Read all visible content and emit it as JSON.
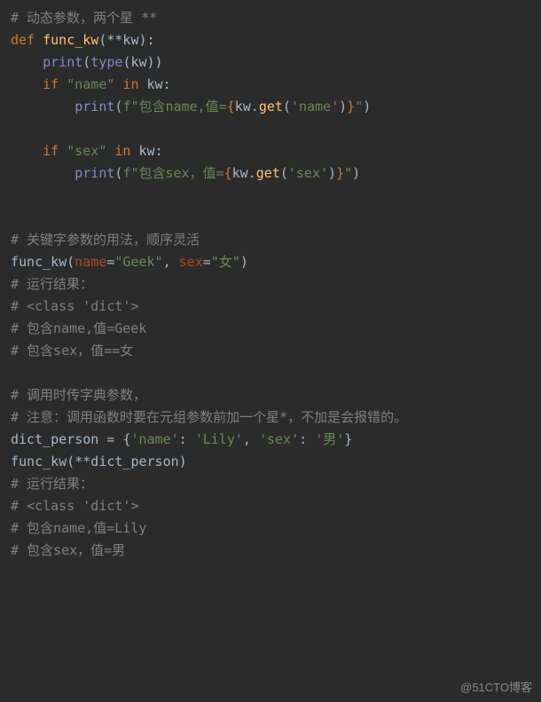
{
  "lines": {
    "c1": "# 动态参数，两个星 **",
    "def": "def",
    "func_kw": "func_kw",
    "kw_param": "**kw",
    "print": "print",
    "type": "type",
    "kw": "kw",
    "if": "if",
    "str_name": "\"name\"",
    "in": "in",
    "fstr1_a": "f\"包含name,值=",
    "get": "get",
    "str_name_s": "'name'",
    "fstr_end": "\"",
    "str_sex": "\"sex\"",
    "fstr2_a": "f\"包含sex，值=",
    "str_sex_s": "'sex'",
    "c2": "# 关键字参数的用法，顺序灵活",
    "name_kw": "name",
    "eq": "=",
    "str_geek": "\"Geek\"",
    "comma_sp": ", ",
    "sex_kw": "sex",
    "str_female": "\"女\"",
    "c3": "# 运行结果：",
    "c4": "# <class 'dict'>",
    "c5": "# 包含name,值=Geek",
    "c6": "# 包含sex，值==女",
    "c7": "# 调用时传字典参数，",
    "c8": "# 注意：调用函数时要在元组参数前加一个星*，不加是会报错的。",
    "dict_person": "dict_person",
    "assign": " = ",
    "d_name": "'name'",
    "colon_sp": ": ",
    "d_lily": "'Lily'",
    "d_sex": "'sex'",
    "d_male": "'男'",
    "star_star": "**dict_person",
    "c9": "# 运行结果：",
    "c10": "# <class 'dict'>",
    "c11": "# 包含name,值=Lily",
    "c12": "# 包含sex，值=男"
  },
  "watermark": "@51CTO博客"
}
